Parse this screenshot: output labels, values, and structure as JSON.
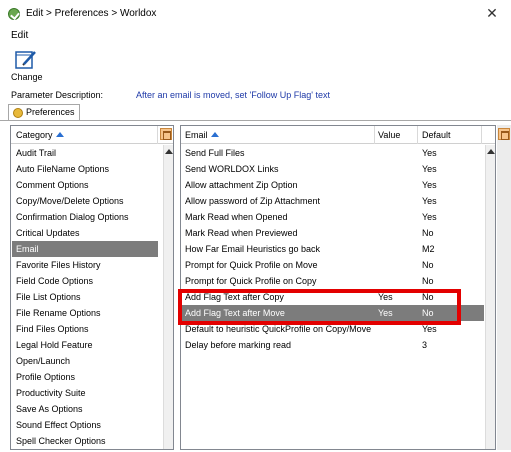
{
  "window": {
    "title": "Edit > Preferences > Worldox",
    "close_glyph": "✕",
    "icon": "worldox-check-icon"
  },
  "menu": {
    "edit_label": "Edit"
  },
  "toolbar": {
    "change_label": "Change",
    "change_icon": "notepad-edit-icon"
  },
  "param": {
    "label": "Parameter Description:",
    "value": "After an email is moved, set 'Follow Up Flag' text"
  },
  "tab": {
    "label": "Preferences",
    "icon": "preferences-icon"
  },
  "category_panel": {
    "header": "Category",
    "items": [
      "Audit Trail",
      "Auto FileName Options",
      "Comment Options",
      "Copy/Move/Delete Options",
      "Confirmation Dialog Options",
      "Critical Updates",
      "Email",
      "Favorite Files History",
      "Field Code Options",
      "File List Options",
      "File Rename Options",
      "Find Files Options",
      "Legal Hold Feature",
      "Open/Launch",
      "Profile Options",
      "Productivity Suite",
      "Save As Options",
      "Sound Effect Options",
      "Spell Checker Options"
    ],
    "selected_index": 6
  },
  "email_panel": {
    "headers": {
      "name": "Email",
      "value": "Value",
      "default": "Default"
    },
    "rows": [
      {
        "name": "Send Full Files",
        "value": "",
        "default": "Yes"
      },
      {
        "name": "Send WORLDOX Links",
        "value": "",
        "default": "Yes"
      },
      {
        "name": "Allow attachment Zip Option",
        "value": "",
        "default": "Yes"
      },
      {
        "name": "Allow password of Zip Attachment",
        "value": "",
        "default": "Yes"
      },
      {
        "name": "Mark Read when Opened",
        "value": "",
        "default": "Yes"
      },
      {
        "name": "Mark Read when Previewed",
        "value": "",
        "default": "No"
      },
      {
        "name": "How Far Email Heuristics go back",
        "value": "",
        "default": "M2"
      },
      {
        "name": "Prompt for Quick Profile on Move",
        "value": "",
        "default": "No"
      },
      {
        "name": "Prompt for Quick Profile on Copy",
        "value": "",
        "default": "No"
      },
      {
        "name": "Add Flag Text after Copy",
        "value": "Yes",
        "default": "No"
      },
      {
        "name": "Add Flag Text after Move",
        "value": "Yes",
        "default": "No"
      },
      {
        "name": "Default to heuristic QuickProfile on Copy/Move",
        "value": "",
        "default": "Yes"
      },
      {
        "name": "Delay before marking read",
        "value": "",
        "default": "3"
      }
    ],
    "selected_index": 10
  },
  "annotation": {
    "highlight_color": "#e30000"
  }
}
